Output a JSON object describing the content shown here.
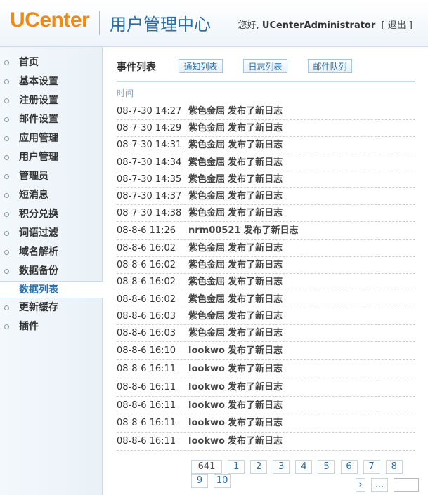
{
  "header": {
    "logo": "UCenter",
    "title": "用户管理中心",
    "greeting": "您好,",
    "username": "UCenterAdministrator",
    "logout_label": "退出",
    "bracket_open": "[",
    "bracket_close": "]"
  },
  "sidebar": {
    "items": [
      {
        "label": "首页"
      },
      {
        "label": "基本设置"
      },
      {
        "label": "注册设置"
      },
      {
        "label": "邮件设置"
      },
      {
        "label": "应用管理"
      },
      {
        "label": "用户管理"
      },
      {
        "label": "管理员"
      },
      {
        "label": "短消息"
      },
      {
        "label": "积分兑换"
      },
      {
        "label": "词语过滤"
      },
      {
        "label": "域名解析"
      },
      {
        "label": "数据备份"
      },
      {
        "label": "数据列表"
      },
      {
        "label": "更新缓存"
      },
      {
        "label": "插件"
      }
    ]
  },
  "main": {
    "section_title": "事件列表",
    "tabs": [
      {
        "label": "通知列表"
      },
      {
        "label": "日志列表"
      },
      {
        "label": "邮件队列"
      }
    ],
    "column_header": "时间",
    "rows": [
      {
        "time": "08-7-30 14:27",
        "author": "紫色金屈",
        "action": "发布了新日志"
      },
      {
        "time": "08-7-30 14:29",
        "author": "紫色金屈",
        "action": "发布了新日志"
      },
      {
        "time": "08-7-30 14:31",
        "author": "紫色金屈",
        "action": "发布了新日志"
      },
      {
        "time": "08-7-30 14:34",
        "author": "紫色金屈",
        "action": "发布了新日志"
      },
      {
        "time": "08-7-30 14:35",
        "author": "紫色金屈",
        "action": "发布了新日志"
      },
      {
        "time": "08-7-30 14:37",
        "author": "紫色金屈",
        "action": "发布了新日志"
      },
      {
        "time": "08-7-30 14:38",
        "author": "紫色金屈",
        "action": "发布了新日志"
      },
      {
        "time": "08-8-6 11:26",
        "author": "nrm00521",
        "action": "发布了新日志"
      },
      {
        "time": "08-8-6 16:02",
        "author": "紫色金屈",
        "action": "发布了新日志"
      },
      {
        "time": "08-8-6 16:02",
        "author": "紫色金屈",
        "action": "发布了新日志"
      },
      {
        "time": "08-8-6 16:02",
        "author": "紫色金屈",
        "action": "发布了新日志"
      },
      {
        "time": "08-8-6 16:02",
        "author": "紫色金屈",
        "action": "发布了新日志"
      },
      {
        "time": "08-8-6 16:03",
        "author": "紫色金屈",
        "action": "发布了新日志"
      },
      {
        "time": "08-8-6 16:03",
        "author": "紫色金屈",
        "action": "发布了新日志"
      },
      {
        "time": "08-8-6 16:10",
        "author": "lookwo",
        "action": "发布了新日志"
      },
      {
        "time": "08-8-6 16:11",
        "author": "lookwo",
        "action": "发布了新日志"
      },
      {
        "time": "08-8-6 16:11",
        "author": "lookwo",
        "action": "发布了新日志"
      },
      {
        "time": "08-8-6 16:11",
        "author": "lookwo",
        "action": "发布了新日志"
      },
      {
        "time": "08-8-6 16:11",
        "author": "lookwo",
        "action": "发布了新日志"
      },
      {
        "time": "08-8-6 16:11",
        "author": "lookwo",
        "action": "发布了新日志"
      }
    ]
  },
  "pagination": {
    "total": "641",
    "pages": [
      "1",
      "2",
      "3",
      "4",
      "5",
      "6",
      "7",
      "8",
      "9",
      "10"
    ],
    "next": "›",
    "ellipsis": "...",
    "goto_value": ""
  },
  "colors": {
    "logo": "#f08a12",
    "brand_blue": "#2a6fa8",
    "sidebar_bg": "#e9f1f8",
    "border": "#c9dcec"
  },
  "icons": {
    "nav_bullet": "circle-bullet-icon",
    "next_page": "chevron-right-icon"
  }
}
